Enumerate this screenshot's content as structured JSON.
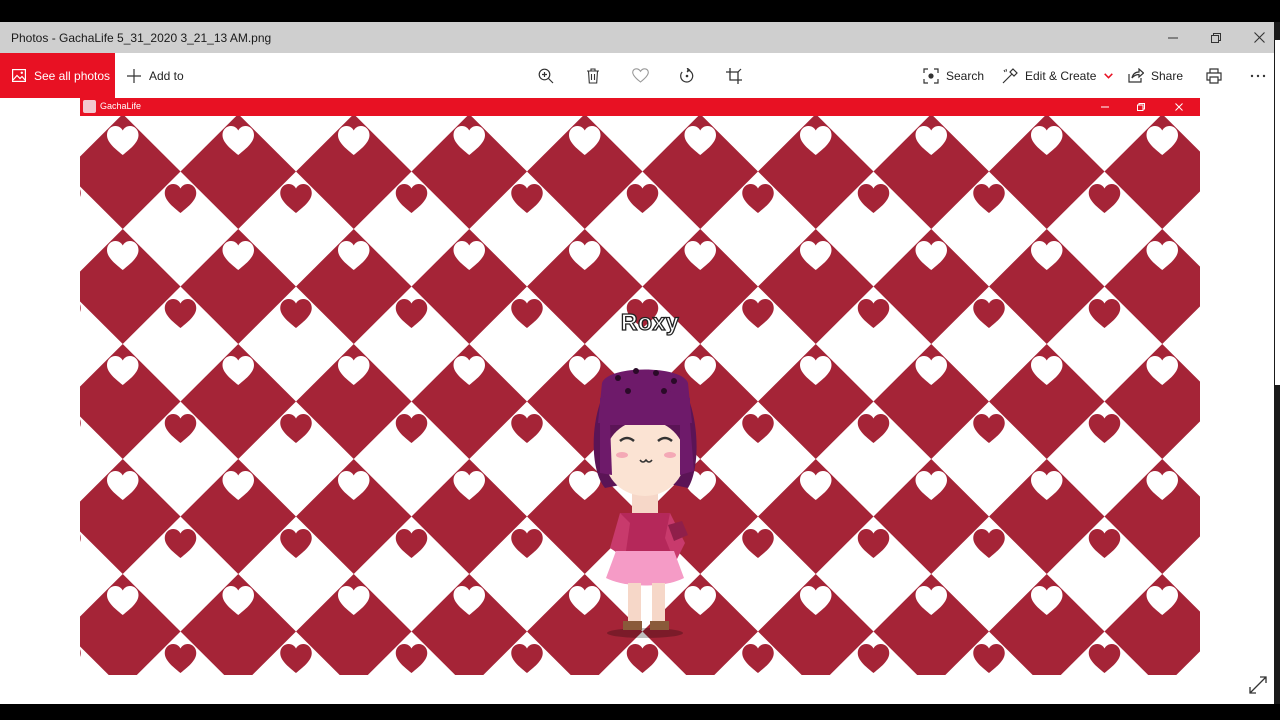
{
  "window": {
    "title": "Photos - GachaLife 5_31_2020 3_21_13 AM.png"
  },
  "toolbar": {
    "see_all_photos": "See all photos",
    "add_to": "Add to",
    "search": "Search",
    "edit_create": "Edit & Create",
    "share": "Share"
  },
  "icons": {
    "minimize": "minimize-icon",
    "restore": "restore-icon",
    "close": "close-icon",
    "photos": "photos-icon",
    "add": "plus-icon",
    "zoom": "zoom-in-icon",
    "delete": "trash-icon",
    "favorite": "heart-icon",
    "rotate": "rotate-icon",
    "crop": "crop-icon",
    "search": "visual-search-icon",
    "edit": "edit-create-icon",
    "share": "share-icon",
    "print": "print-icon",
    "more": "more-icon",
    "fullscreen": "fullscreen-icon"
  },
  "colors": {
    "accent": "#e81123",
    "heart_red": "#a52437",
    "background_white": "#ffffff"
  },
  "image": {
    "app_title": "GachaLife",
    "character_name": "Roxy"
  }
}
